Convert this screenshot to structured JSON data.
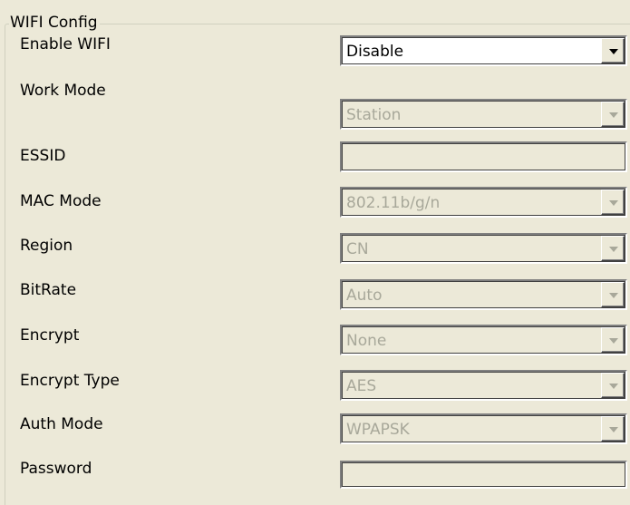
{
  "group_title": "WIFI Config",
  "fields": [
    {
      "label": "Enable WIFI",
      "type": "select",
      "value": "Disable",
      "enabled": true,
      "icon": "chevron-down-icon"
    },
    {
      "label": "Work Mode",
      "type": "select",
      "value": "Station",
      "enabled": false,
      "icon": "chevron-down-icon"
    },
    {
      "label": "ESSID",
      "type": "text",
      "value": "",
      "enabled": false
    },
    {
      "label": "MAC Mode",
      "type": "select",
      "value": "802.11b/g/n",
      "enabled": false,
      "icon": "chevron-down-icon"
    },
    {
      "label": "Region",
      "type": "select",
      "value": "CN",
      "enabled": false,
      "icon": "chevron-down-icon"
    },
    {
      "label": "BitRate",
      "type": "select",
      "value": "Auto",
      "enabled": false,
      "icon": "chevron-down-icon"
    },
    {
      "label": "Encrypt",
      "type": "select",
      "value": "None",
      "enabled": false,
      "icon": "chevron-down-icon"
    },
    {
      "label": "Encrypt Type",
      "type": "select",
      "value": "AES",
      "enabled": false,
      "icon": "chevron-down-icon"
    },
    {
      "label": "Auth Mode",
      "type": "select",
      "value": "WPAPSK",
      "enabled": false,
      "icon": "chevron-down-icon"
    },
    {
      "label": "Password",
      "type": "text",
      "value": "",
      "enabled": false
    }
  ],
  "colors": {
    "background": "#ece9d8",
    "field_enabled": "#ffffff",
    "disabled_text": "#a8a89a",
    "group_border": "#d0d0bf"
  }
}
